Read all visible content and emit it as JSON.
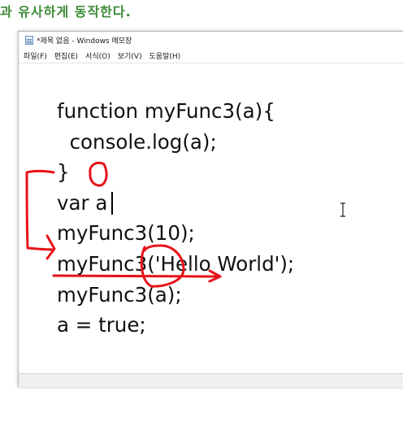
{
  "caption": "과 유사하게 동작한다.",
  "window": {
    "title": "*제목 없음 - Windows 메모장",
    "menu": [
      "파일(F)",
      "편집(E)",
      "서식(O)",
      "보기(V)",
      "도움말(H)"
    ]
  },
  "editor": {
    "lines": [
      "function myFunc3(a){",
      "  console.log(a);",
      "}",
      "var a",
      "myFunc3(10);",
      "myFunc3('Hello World');",
      "myFunc3(a);",
      "a = true;"
    ]
  },
  "annotation_color": "#e8121a",
  "caption_color": "#3c8a36"
}
